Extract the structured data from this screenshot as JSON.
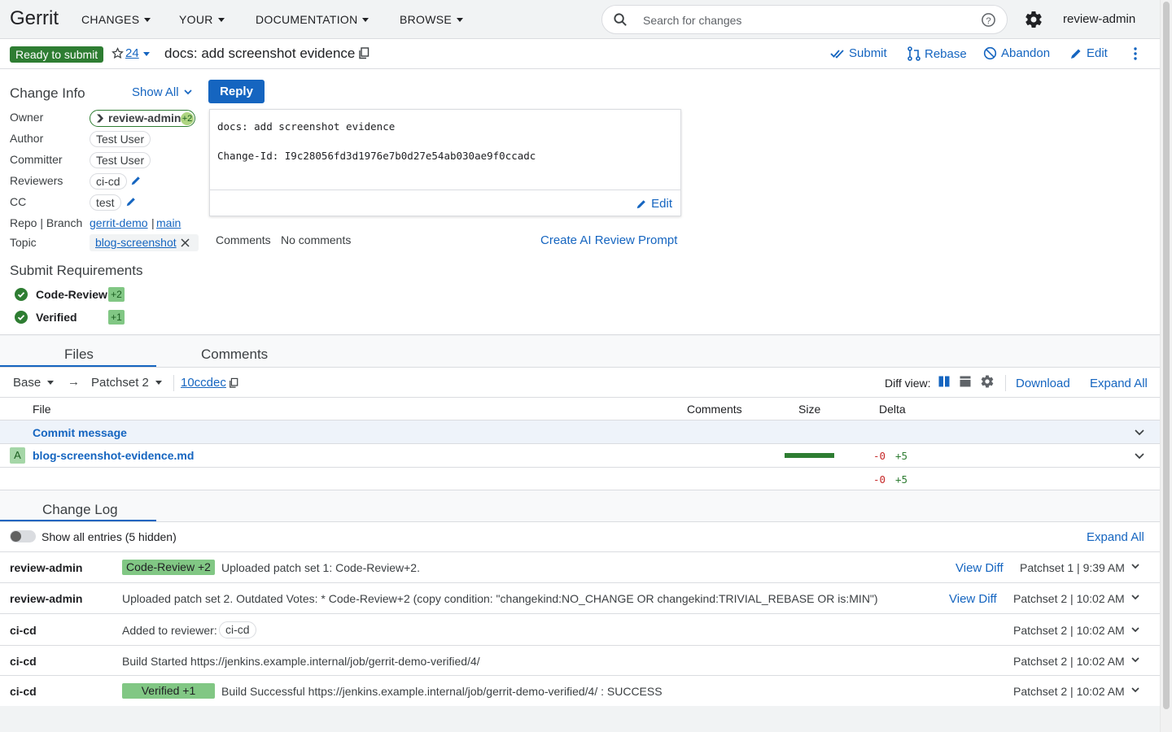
{
  "brand": "Gerrit",
  "nav": [
    {
      "label": "CHANGES"
    },
    {
      "label": "YOUR"
    },
    {
      "label": "DOCUMENTATION"
    },
    {
      "label": "BROWSE"
    }
  ],
  "search": {
    "placeholder": "Search for changes"
  },
  "user": "review-admin",
  "change": {
    "status": "Ready to submit",
    "patchset_count": "24",
    "subject": "docs: add screenshot evidence",
    "actions": {
      "submit": "Submit",
      "rebase": "Rebase",
      "abandon": "Abandon",
      "edit": "Edit"
    }
  },
  "info": {
    "title": "Change Info",
    "show_all": "Show All",
    "labels": {
      "owner": "Owner",
      "author": "Author",
      "committer": "Committer",
      "reviewers": "Reviewers",
      "cc": "CC",
      "repo_branch": "Repo | Branch",
      "topic": "Topic"
    },
    "owner": {
      "name": "review-admin",
      "vote": "+2"
    },
    "author": "Test User",
    "committer": "Test User",
    "reviewer": "ci-cd",
    "cc": "test",
    "repo": "gerrit-demo",
    "branch_sep": "|",
    "branch": "main",
    "topic": "blog-screenshot"
  },
  "submit_requirements": {
    "title": "Submit Requirements",
    "items": [
      {
        "name": "Code-Review",
        "value": "+2"
      },
      {
        "name": "Verified",
        "value": "+1"
      }
    ]
  },
  "reply": "Reply",
  "commit": {
    "message": "docs: add screenshot evidence\n\nChange-Id: I9c28056fd3d1976e7b0d27e54ab030ae9f0ccadc",
    "edit": "Edit",
    "comments_label": "Comments",
    "comments_value": "No comments",
    "ai_prompt": "Create AI Review Prompt"
  },
  "files": {
    "tabs": [
      "Files",
      "Comments"
    ],
    "base": "Base",
    "arrow": "→",
    "patchset": "Patchset 2",
    "commit_hash": "10ccdec",
    "diff_view_label": "Diff view:",
    "download": "Download",
    "expand_all": "Expand All",
    "headers": {
      "file": "File",
      "comments": "Comments",
      "size": "Size",
      "delta": "Delta"
    },
    "commit_message_row": "Commit message",
    "rows": [
      {
        "status": "A",
        "name": "blog-screenshot-evidence.md",
        "deleted": "-0",
        "added": "+5"
      }
    ],
    "total": {
      "deleted": "-0",
      "added": "+5"
    }
  },
  "change_log": {
    "title": "Change Log",
    "toggle_label": "Show all entries (5 hidden)",
    "expand_all": "Expand All",
    "entries": [
      {
        "author": "review-admin",
        "badge": "Code-Review +2",
        "message": "Uploaded patch set 1: Code-Review+2.",
        "view_diff": "View Diff",
        "patchset": "Patchset 1 | 9:39 AM"
      },
      {
        "author": "review-admin",
        "badge": "",
        "message": "Uploaded patch set 2. Outdated Votes: * Code-Review+2 (copy condition: \"changekind:NO_CHANGE OR changekind:TRIVIAL_REBASE OR is:MIN\")",
        "view_diff": "View Diff",
        "patchset": "Patchset 2 | 10:02 AM"
      },
      {
        "author": "ci-cd",
        "badge": "",
        "message": "Added to reviewer:",
        "chip": "ci-cd",
        "view_diff": "",
        "patchset": "Patchset 2 | 10:02 AM"
      },
      {
        "author": "ci-cd",
        "badge": "",
        "message": "Build Started https://jenkins.example.internal/job/gerrit-demo-verified/4/",
        "view_diff": "",
        "patchset": "Patchset 2 | 10:02 AM"
      },
      {
        "author": "ci-cd",
        "badge": "Verified +1",
        "message": "Build Successful https://jenkins.example.internal/job/gerrit-demo-verified/4/ : SUCCESS",
        "view_diff": "",
        "patchset": "Patchset 2 | 10:02 AM"
      }
    ]
  },
  "colors": {
    "accent": "#1565c0",
    "status_ready": "#2e7d32",
    "vote_green": "#81c784"
  }
}
